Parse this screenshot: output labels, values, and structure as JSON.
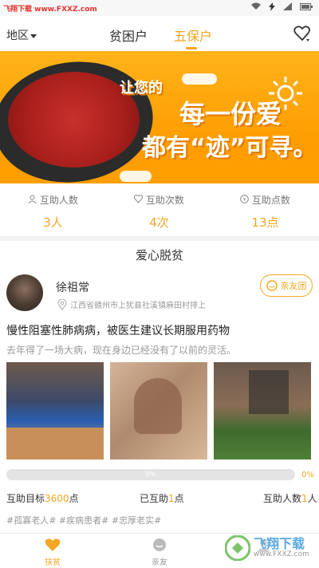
{
  "statusbar": {
    "watermark": "飞翔下载 www.FXXZ.com"
  },
  "header": {
    "region_label": "地区",
    "tabs": [
      {
        "label": "贫困户"
      },
      {
        "label": "五保户"
      }
    ],
    "active_tab": 1
  },
  "banner": {
    "line1": "让您的",
    "line2": "每一份爱",
    "line3": "都有“迹”可寻。"
  },
  "stats": [
    {
      "label": "互助人数",
      "value": "3人",
      "icon": "user-icon"
    },
    {
      "label": "互助次数",
      "value": "4次",
      "icon": "heart-outline-icon"
    },
    {
      "label": "互助点数",
      "value": "13点",
      "icon": "coin-icon"
    }
  ],
  "section": {
    "title": "爱心脱贫"
  },
  "card": {
    "name": "徐祖常",
    "address": "江西省赣州市上犹县社溪镇麻田村排上",
    "family_button": "亲友团",
    "title": "慢性阻塞性肺病病，被医生建议长期服用药物",
    "description": "去年得了一场大病，现在身边已经没有了以前的灵活。",
    "progress_fraction": 0.0,
    "progress_text": "0%",
    "progress_side_text": "0%",
    "goal_label": "互助目标",
    "goal_value": "3600",
    "goal_unit": "点",
    "helped_label": "已互助",
    "helped_value": "1",
    "helped_unit": "点",
    "people_label": "互助人数",
    "people_value": "1",
    "people_unit": "人",
    "tags": "#孤寡老人#  #疾病患者#  #忠厚老实#"
  },
  "tabbar": [
    {
      "label": "扶贫",
      "icon": "heart-icon"
    },
    {
      "label": "亲友",
      "icon": "chat-icon"
    },
    {
      "label": "",
      "icon": "profile-icon"
    }
  ],
  "watermark_bottom": {
    "text": "飞翔下载",
    "sub": "www.FXXZ.com"
  },
  "colors": {
    "accent": "#f5a623",
    "banner": "#ffa800"
  }
}
